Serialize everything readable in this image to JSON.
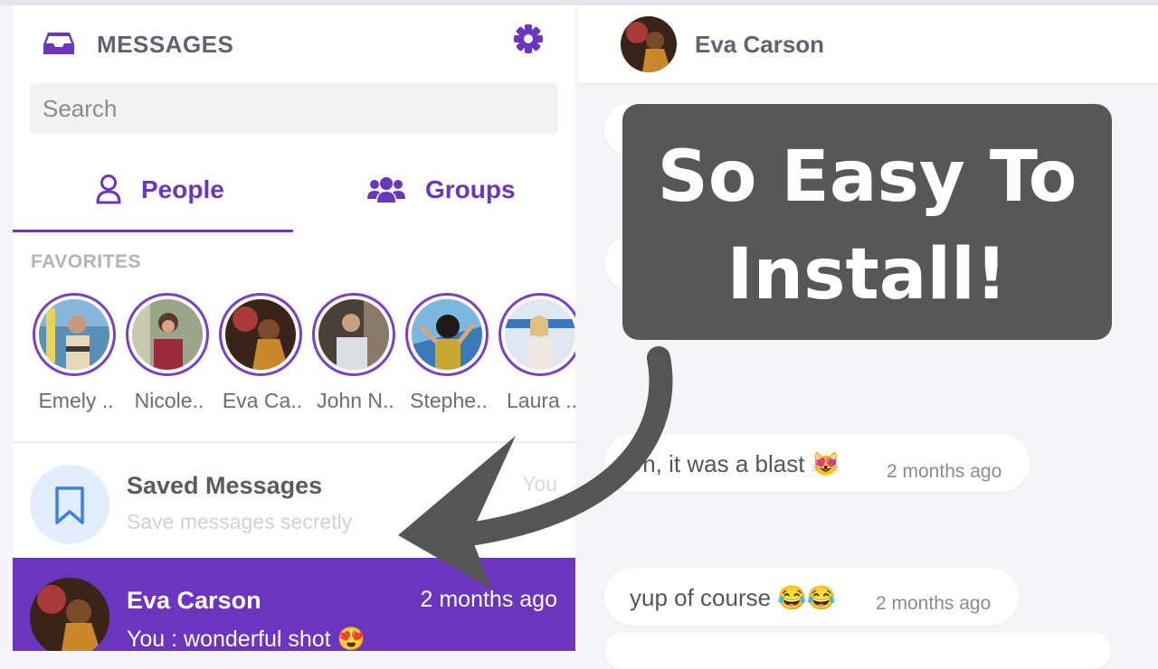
{
  "sidebar": {
    "title": "MESSAGES",
    "search_placeholder": "Search",
    "tabs": [
      {
        "label": "People",
        "active": true
      },
      {
        "label": "Groups",
        "active": false
      }
    ],
    "favorites_title": "FAVORITES",
    "favorites": [
      {
        "name": "Emely .."
      },
      {
        "name": "Nicole.."
      },
      {
        "name": "Eva Ca.."
      },
      {
        "name": "John N.."
      },
      {
        "name": "Stephe.."
      },
      {
        "name": "Laura .."
      }
    ],
    "saved": {
      "title": "Saved Messages",
      "subtitle": "Save messages secretly",
      "time": "You"
    },
    "active_chat": {
      "name": "Eva Carson",
      "time": "2 months ago",
      "message": "You : wonderful shot 😍"
    }
  },
  "chat": {
    "contact_name": "Eva Carson",
    "messages": [
      {
        "text": "Oh, it was a blast 😻",
        "time": "2 months ago"
      },
      {
        "text": "yup of course 😂😂",
        "time": "2 months ago"
      }
    ]
  },
  "overlay": {
    "line1": "So Easy To",
    "line2": "Install!"
  },
  "colors": {
    "accent": "#6b35c0",
    "callout_bg": "#575757",
    "arrow": "#555555"
  },
  "icons": {
    "header": "inbox-icon",
    "settings": "gear-icon",
    "people_tab": "user-icon",
    "groups_tab": "users-icon",
    "saved": "bookmark-icon"
  }
}
